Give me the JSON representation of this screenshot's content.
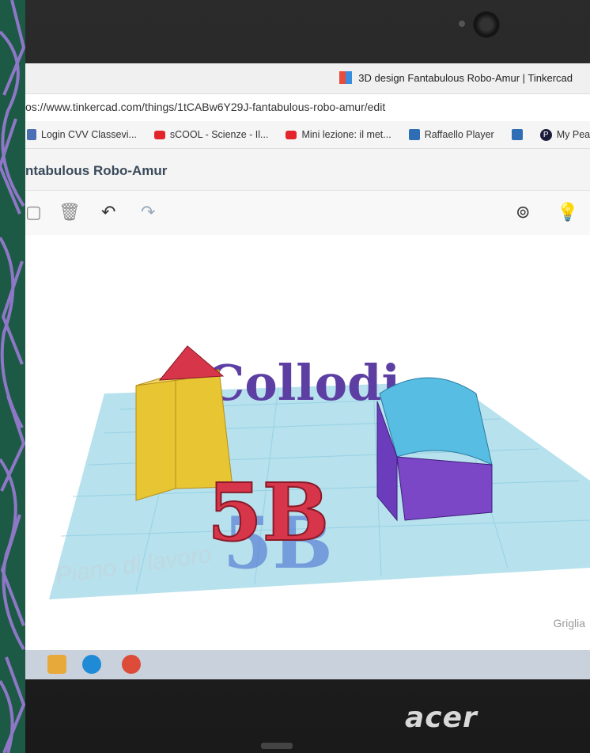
{
  "browser": {
    "tab_title": "3D design Fantabulous Robo-Amur | Tinkercad",
    "url": "os://www.tinkercad.com/things/1tCABw6Y29J-fantabulous-robo-amur/edit",
    "bookmarks": [
      {
        "label": "Login CVV Classevi...",
        "icon": "s-icon"
      },
      {
        "label": "sCOOL - Scienze - Il...",
        "icon": "youtube-icon"
      },
      {
        "label": "Mini lezione: il met...",
        "icon": "youtube-icon"
      },
      {
        "label": "Raffaello Player",
        "icon": "app-icon"
      },
      {
        "label": "",
        "icon": "app-icon"
      },
      {
        "label": "My Pearso",
        "icon": "pearson-icon"
      }
    ]
  },
  "app": {
    "design_name": "ntabulous Robo-Amur",
    "grid_label": "Griglia",
    "workplane_label": "Piano di lavoro"
  },
  "scene": {
    "text_3d": "Collodi",
    "class_label": "5B"
  },
  "laptop": {
    "brand": "acer"
  },
  "colors": {
    "workplane": "#a9dcea",
    "text_purple": "#5d3fa3",
    "red": "#d7364a",
    "yellow": "#e8c533",
    "cyan": "#57bde3",
    "violet": "#7b47c7"
  }
}
